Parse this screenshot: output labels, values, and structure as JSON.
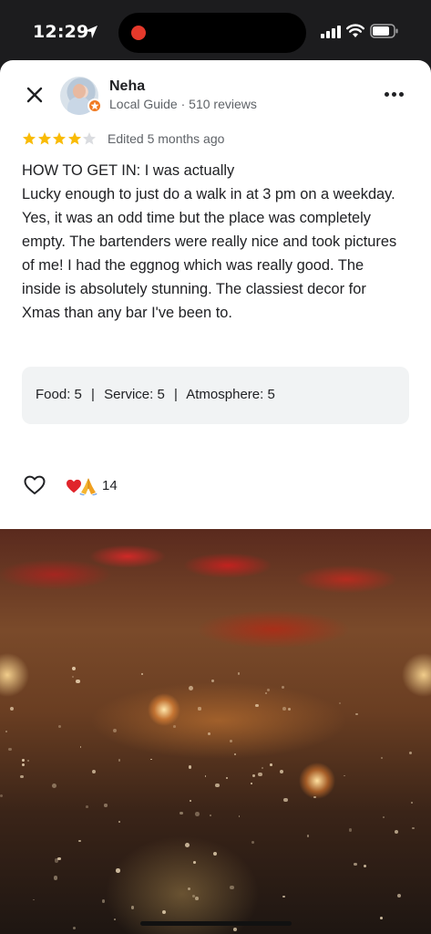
{
  "status_bar": {
    "time": "12:29",
    "location_icon": "location-arrow-icon",
    "recording_indicator": "recording-dot-icon",
    "signal_icon": "cellular-signal-icon",
    "wifi_icon": "wifi-icon",
    "battery_icon": "battery-icon"
  },
  "header": {
    "close_icon": "close-icon",
    "reviewer_name": "Neha",
    "reviewer_meta": "Local Guide · 510 reviews",
    "badge_icon": "local-guide-star-icon",
    "more_icon": "more-horizontal-icon"
  },
  "review": {
    "rating": 4,
    "max_rating": 5,
    "edited": "Edited 5 months ago",
    "text": "HOW TO GET IN: I was actually\nLucky enough to just do a walk in at 3 pm on a weekday. Yes, it was an odd time but the place was completely empty. The bartenders were really nice and took pictures of me! I had the eggnog which was really good. The inside is absolutely stunning. The classiest decor for Xmas than any bar I've been to."
  },
  "ratings": {
    "food_label": "Food:",
    "food_value": "5",
    "service_label": "Service:",
    "service_value": "5",
    "atmosphere_label": "Atmosphere:",
    "atmosphere_value": "5",
    "separator": "|"
  },
  "reactions": {
    "like_icon": "heart-outline-icon",
    "emojis": [
      "heart-emoji",
      "pray-emoji"
    ],
    "count": "14"
  },
  "colors": {
    "star_filled": "#f9bb05",
    "star_empty": "#dadce0",
    "badge": "#f07a22",
    "ratings_bg": "#f1f3f4"
  }
}
